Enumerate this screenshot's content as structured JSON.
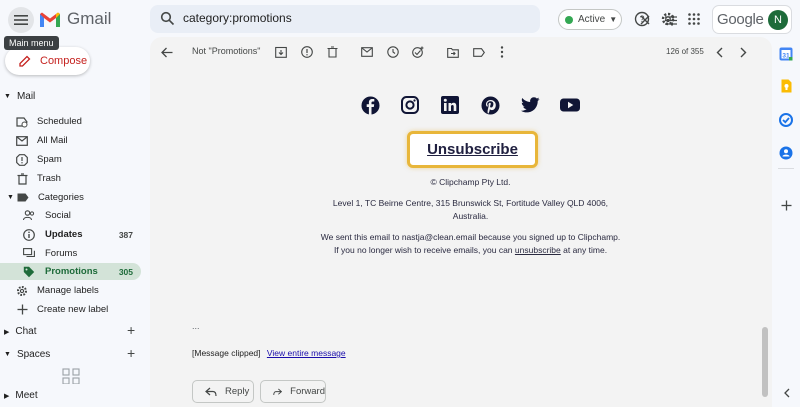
{
  "header": {
    "app_name": "Gmail",
    "menu_tooltip": "Main menu",
    "search_value": "category:promotions",
    "status_label": "Active",
    "brand_word": "Google",
    "avatar_initial": "N"
  },
  "sidebar": {
    "compose_label": "Compose",
    "mail_section": "Mail",
    "items": [
      {
        "label": "Scheduled",
        "icon": "scheduled-icon"
      },
      {
        "label": "All Mail",
        "icon": "all-mail-icon"
      },
      {
        "label": "Spam",
        "icon": "spam-icon"
      },
      {
        "label": "Trash",
        "icon": "trash-icon"
      },
      {
        "label": "Categories",
        "icon": "label-icon"
      }
    ],
    "categories": [
      {
        "label": "Social",
        "count": "",
        "icon": "social-icon"
      },
      {
        "label": "Updates",
        "count": "387",
        "icon": "updates-icon"
      },
      {
        "label": "Forums",
        "count": "",
        "icon": "forums-icon"
      },
      {
        "label": "Promotions",
        "count": "305",
        "icon": "promotions-icon"
      }
    ],
    "manage_labels": "Manage labels",
    "create_label": "Create new label",
    "chat_section": "Chat",
    "spaces_section": "Spaces",
    "meet_section": "Meet"
  },
  "toolbar": {
    "label_chip": "Not \"Promotions\"",
    "page_count": "126 of 355"
  },
  "email": {
    "unsubscribe_button": "Unsubscribe",
    "copyright": "© Clipchamp Pty Ltd.",
    "address_line1": "Level 1, TC Beirne Centre, 315 Brunswick St, Fortitude Valley QLD 4006,",
    "address_line2": "Australia.",
    "notice_line1": "We sent this email to nastja@clean.email because you signed up to Clipchamp.",
    "notice_line2_pre": "If you no longer wish to receive emails, you can",
    "notice_link": "unsubscribe",
    "notice_line2_post": "at any time.",
    "ellipsis": "...",
    "clipped_text": "[Message clipped]",
    "view_entire": "View entire message"
  },
  "actions": {
    "reply": "Reply",
    "forward": "Forward"
  },
  "colors": {
    "accent_green": "#1e6b3a",
    "selected_bg": "#d3e3d8",
    "unsubscribe_border": "#e8b63a",
    "compose_red": "#c5221f"
  }
}
